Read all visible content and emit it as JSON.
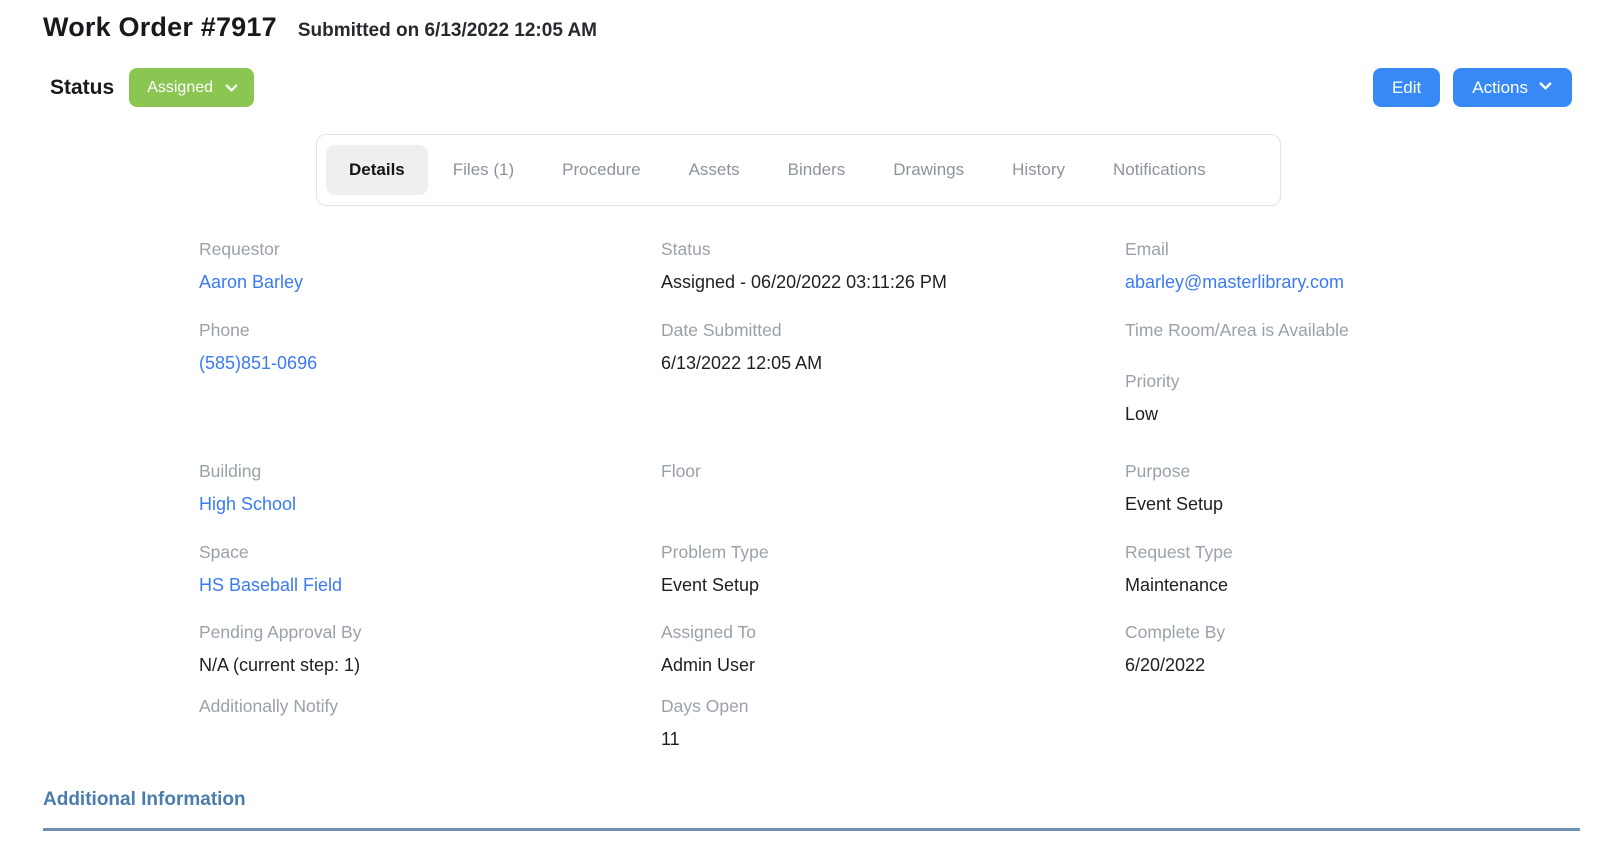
{
  "header": {
    "title": "Work Order #7917",
    "submitted": "Submitted on 6/13/2022 12:05 AM"
  },
  "status_bar": {
    "label": "Status",
    "badge": "Assigned",
    "edit_label": "Edit",
    "actions_label": "Actions"
  },
  "tabs": [
    {
      "label": "Details",
      "active": true
    },
    {
      "label": "Files (1)",
      "active": false
    },
    {
      "label": "Procedure",
      "active": false
    },
    {
      "label": "Assets",
      "active": false
    },
    {
      "label": "Binders",
      "active": false
    },
    {
      "label": "Drawings",
      "active": false
    },
    {
      "label": "History",
      "active": false
    },
    {
      "label": "Notifications",
      "active": false
    }
  ],
  "details": {
    "requestor": {
      "label": "Requestor",
      "value": "Aaron Barley"
    },
    "status": {
      "label": "Status",
      "value": "Assigned - 06/20/2022 03:11:26 PM"
    },
    "email": {
      "label": "Email",
      "value": "abarley@masterlibrary.com"
    },
    "phone": {
      "label": "Phone",
      "value": "(585)851-0696"
    },
    "date_submitted": {
      "label": "Date Submitted",
      "value": "6/13/2022 12:05 AM"
    },
    "time_room_available": {
      "label": "Time Room/Area is Available",
      "value": ""
    },
    "priority": {
      "label": "Priority",
      "value": "Low"
    },
    "building": {
      "label": "Building",
      "value": "High School"
    },
    "floor": {
      "label": "Floor",
      "value": ""
    },
    "purpose": {
      "label": "Purpose",
      "value": "Event Setup"
    },
    "space": {
      "label": "Space",
      "value": "HS Baseball Field"
    },
    "problem_type": {
      "label": "Problem Type",
      "value": "Event Setup"
    },
    "request_type": {
      "label": "Request Type",
      "value": "Maintenance"
    },
    "pending_approval_by": {
      "label": "Pending Approval By",
      "value": "N/A (current step: 1)"
    },
    "assigned_to": {
      "label": "Assigned To",
      "value": "Admin User"
    },
    "complete_by": {
      "label": "Complete By",
      "value": "6/20/2022"
    },
    "additionally_notify": {
      "label": "Additionally Notify",
      "value": ""
    },
    "days_open": {
      "label": "Days Open",
      "value": "11"
    }
  },
  "footer": {
    "section_title": "Additional Information"
  },
  "colors": {
    "accent_blue": "#3789f5",
    "status_green": "#8bc653",
    "link_blue": "#3a7af2",
    "section_heading_blue": "#4b7cae",
    "divider_blue": "#6b8fb8",
    "label_gray": "#9aa1aa"
  }
}
